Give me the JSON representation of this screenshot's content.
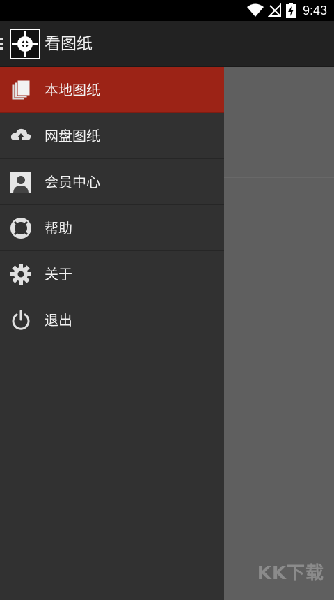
{
  "status_bar": {
    "time": "9:43",
    "icons": [
      "wifi-icon",
      "no-signal-icon",
      "battery-charging-icon"
    ]
  },
  "app_bar": {
    "title": "看图纸",
    "menu_icon": "hamburger-icon",
    "logo_icon": "crosshair-logo-icon"
  },
  "drawer": {
    "items": [
      {
        "label": "本地图纸",
        "icon": "documents-icon",
        "active": true
      },
      {
        "label": "网盘图纸",
        "icon": "cloud-upload-icon",
        "active": false
      },
      {
        "label": "会员中心",
        "icon": "user-profile-icon",
        "active": false
      },
      {
        "label": "帮助",
        "icon": "lifebuoy-icon",
        "active": false
      },
      {
        "label": "关于",
        "icon": "gear-icon",
        "active": false
      },
      {
        "label": "退出",
        "icon": "power-icon",
        "active": false
      }
    ]
  },
  "watermark": "KK下载",
  "colors": {
    "active_item": "#9c2316",
    "drawer_bg": "#313131",
    "app_bar_bg": "#222222",
    "content_bg": "#5f5f5f"
  }
}
